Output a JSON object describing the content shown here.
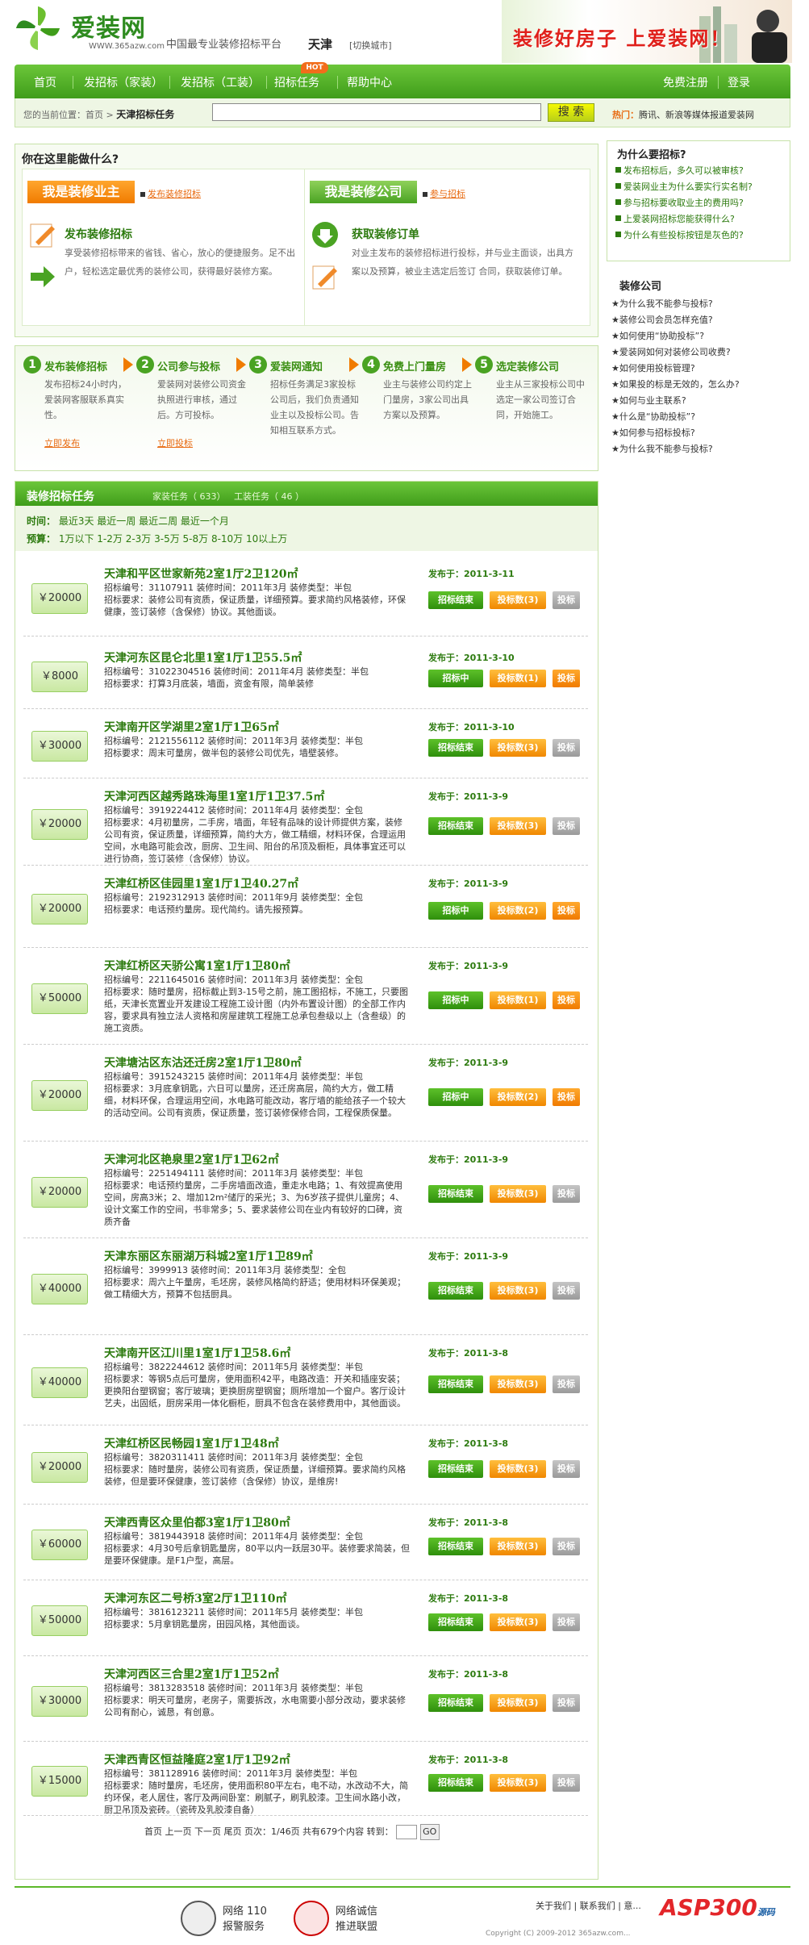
{
  "header": {
    "logo_name": "爱装网",
    "logo_url": "WWW.365azw.com",
    "slogan": "中国最专业装修招标平台",
    "city": "天津",
    "switch_city": "[切换城市]",
    "banner": "装修好房子 上爱装网！"
  },
  "nav": {
    "items": [
      "首页",
      "发招标（家装）",
      "发招标（工装）",
      "招标任务",
      "帮助中心"
    ],
    "hot": "HOT",
    "register": "免费注册",
    "login": "登录"
  },
  "subbar": {
    "crumb_prefix": "您的当前位置：首页 >",
    "crumb_current": "天津招标任务",
    "search_placeholder": "",
    "search_button": "搜 索",
    "hot_label": "热门：",
    "hot_text": "腾讯、新浪等媒体报道爱装网"
  },
  "intro": {
    "title": "你在这里能做什么?",
    "owner": {
      "button": "我是装修业主",
      "link": "发布装修招标",
      "item_title": "发布装修招标",
      "desc": "享受装修招标带来的省钱、省心，放心的便捷服务。足不出户，轻松选定最优秀的装修公司，获得最好装修方案。"
    },
    "company": {
      "button": "我是装修公司",
      "link": "参与招标",
      "item_title": "获取装修订单",
      "desc": "对业主发布的装修招标进行投标，并与业主面谈，出具方案以及预算，被业主选定后签订 合同，获取装修订单。"
    }
  },
  "steps": [
    {
      "num": "1",
      "title": "发布装修招标",
      "desc": "发布招标24小时内，爱装网客服联系真实性。",
      "link": "立即发布"
    },
    {
      "num": "2",
      "title": "公司参与投标",
      "desc": "爱装网对装修公司资金执照进行审核，通过后。方可投标。",
      "link": "立即投标"
    },
    {
      "num": "3",
      "title": "爱装网通知",
      "desc": "招标任务满足3家投标公司后，我们负责通知业主以及投标公司。告知相互联系方式。",
      "link": ""
    },
    {
      "num": "4",
      "title": "免费上门量房",
      "desc": "业主与装修公司约定上门量房，3家公司出具方案以及预算。",
      "link": ""
    },
    {
      "num": "5",
      "title": "选定装修公司",
      "desc": "业主从三家投标公司中选定一家公司签订合同，开始施工。",
      "link": ""
    }
  ],
  "tasks": {
    "title": "装修招标任务",
    "tab_home": "家装任务（ 633）",
    "tab_work": "工装任务（ 46 ）",
    "filter_time_label": "时间：",
    "filter_time": "最近3天  最近一周  最近二周  最近一个月",
    "filter_budget_label": "预算：",
    "filter_budget": "1万以下  1-2万  2-3万  3-5万  5-8万  8-10万  10以上万",
    "items": [
      {
        "price": "￥20000",
        "title": "天津和平区世家新苑2室1厅2卫120㎡",
        "info": "招标编号：31107911   装修时间：2011年3月   装修类型：半包\n招标要求：装修公司有资质，保证质量，详细预算。要求简约风格装修，环保健康，签订装修（含保修）协议。其他面谈。",
        "date": "发布于：2011-3-11",
        "status": "招标结束",
        "bids": "投标数(3)",
        "act": "投标",
        "act_on": false
      },
      {
        "price": "￥8000",
        "title": "天津河东区昆仑北里1室1厅1卫55.5㎡",
        "info": "招标编号：31022304516   装修时间：2011年4月   装修类型：半包\n招标要求：打算3月底装，墙面，资金有限，简单装修",
        "date": "发布于：2011-3-10",
        "status": "招标中",
        "bids": "投标数(1)",
        "act": "投标",
        "act_on": true
      },
      {
        "price": "￥30000",
        "title": "天津南开区学湖里2室1厅1卫65㎡",
        "info": "招标编号：2121556112   装修时间：2011年3月   装修类型：半包\n招标要求：周末可量房，做半包的装修公司优先，墙壁装修。",
        "date": "发布于：2011-3-10",
        "status": "招标结束",
        "bids": "投标数(3)",
        "act": "投标",
        "act_on": false
      },
      {
        "price": "￥20000",
        "title": "天津河西区越秀路珠海里1室1厅1卫37.5㎡",
        "info": "招标编号：3919224412   装修时间：2011年4月   装修类型：全包\n招标要求：4月初量房，二手房，墙面，年轻有品味的设计师提供方案，装修公司有资，保证质量，详细预算，简约大方，做工精细，材料环保，合理运用空间，水电路可能会改，厨房、卫生间、阳台的吊顶及橱柜，具体事宜还可以进行协商，签订装修（含保修）协议。",
        "date": "发布于：2011-3-9",
        "status": "招标结束",
        "bids": "投标数(3)",
        "act": "投标",
        "act_on": false
      },
      {
        "price": "￥20000",
        "title": "天津红桥区佳园里1室1厅1卫40.27㎡",
        "info": "招标编号：2192312913   装修时间：2011年9月   装修类型：全包\n招标要求：电话预约量房。现代简约。请先报预算。",
        "date": "发布于：2011-3-9",
        "status": "招标中",
        "bids": "投标数(2)",
        "act": "投标",
        "act_on": true
      },
      {
        "price": "￥50000",
        "title": "天津红桥区天骄公寓1室1厅1卫80㎡",
        "info": "招标编号：2211645016   装修时间：2011年3月   装修类型：全包\n招标要求：随时量房，招标截止到3-15号之前，施工图招标，不施工，只要图纸，天津长宽置业开发建设工程施工设计图（内外布置设计图）的全部工作内容，要求具有独立法人资格和房屋建筑工程施工总承包叁级以上（含叁级）的施工资质。",
        "date": "发布于：2011-3-9",
        "status": "招标中",
        "bids": "投标数(1)",
        "act": "投标",
        "act_on": true
      },
      {
        "price": "￥20000",
        "title": "天津塘沽区东沽还迁房2室1厅1卫80㎡",
        "info": "招标编号：3915243215   装修时间：2011年4月   装修类型：半包\n招标要求：3月底拿钥匙，六日可以量房，还迁房高层，简约大方，做工精细，材料环保，合理运用空间，水电路可能改动，客厅墙的能给孩子一个较大的活动空间。公司有资质，保证质量，签订装修保修合同，工程保质保量。",
        "date": "发布于：2011-3-9",
        "status": "招标中",
        "bids": "投标数(2)",
        "act": "投标",
        "act_on": true
      },
      {
        "price": "￥20000",
        "title": "天津河北区艳泉里2室1厅1卫62㎡",
        "info": "招标编号：2251494111   装修时间：2011年3月   装修类型：半包\n招标要求：电话预约量房，二手房墙面改造，重走水电路；1、有效提高使用空间，房高3米；2、增加12m²储厅的采光；3、为6岁孩子提供儿童房；4、设计文案工作的空间，书非常多；5、要求装修公司在业内有较好的口碑，资质齐备",
        "date": "发布于：2011-3-9",
        "status": "招标结束",
        "bids": "投标数(3)",
        "act": "投标",
        "act_on": false
      },
      {
        "price": "￥40000",
        "title": "天津东丽区东丽湖万科城2室1厅1卫89㎡",
        "info": "招标编号：3999913   装修时间：2011年3月   装修类型：全包\n招标要求：周六上午量房，毛坯房，装修风格简约舒适；使用材料环保美观；做工精细大方，预算不包括厨具。",
        "date": "发布于：2011-3-9",
        "status": "招标结束",
        "bids": "投标数(3)",
        "act": "投标",
        "act_on": false
      },
      {
        "price": "￥40000",
        "title": "天津南开区江川里1室1厅1卫58.6㎡",
        "info": "招标编号：3822244612   装修时间：2011年5月   装修类型：半包\n招标要求：等钢5点后可量房，使用面积42平，电路改造：开关和插座安装；更换阳台塑钢窗；客厅玻璃；更换厨房塑钢窗；厕所增加一个窗户。客厅设计艺夫，出固纸，厨房采用一体化橱柜，厨具不包含在装修费用中，其他面谈。",
        "date": "发布于：2011-3-8",
        "status": "招标结束",
        "bids": "投标数(3)",
        "act": "投标",
        "act_on": false
      },
      {
        "price": "￥20000",
        "title": "天津红桥区民畅园1室1厅1卫48㎡",
        "info": "招标编号：3820311411   装修时间：2011年3月   装修类型：全包\n招标要求：随时量房，装修公司有资质，保证质量，详细预算。要求简约风格装修，但是要环保健康，签订装修（含保修）协议，是维房!",
        "date": "发布于：2011-3-8",
        "status": "招标结束",
        "bids": "投标数(3)",
        "act": "投标",
        "act_on": false
      },
      {
        "price": "￥60000",
        "title": "天津西青区众里伯都3室1厅1卫80㎡",
        "info": "招标编号：3819443918   装修时间：2011年4月   装修类型：全包\n招标要求：4月30号后拿钥匙量房，80平以内一跃层30平。装修要求简装，但是要环保健康。是F1户型，高层。",
        "date": "发布于：2011-3-8",
        "status": "招标结束",
        "bids": "投标数(3)",
        "act": "投标",
        "act_on": false
      },
      {
        "price": "￥50000",
        "title": "天津河东区二号桥3室2厅1卫110㎡",
        "info": "招标编号：3816123211   装修时间：2011年5月   装修类型：半包\n招标要求：5月拿钥匙量房，田园风格，其他面谈。",
        "date": "发布于：2011-3-8",
        "status": "招标结束",
        "bids": "投标数(3)",
        "act": "投标",
        "act_on": false
      },
      {
        "price": "￥30000",
        "title": "天津河西区三合里2室1厅1卫52㎡",
        "info": "招标编号：3813283518   装修时间：2011年3月   装修类型：半包\n招标要求：明天可量房，老房子，需要拆改，水电需要小部分改动，要求装修公司有耐心，诚恳，有创意。",
        "date": "发布于：2011-3-8",
        "status": "招标结束",
        "bids": "投标数(3)",
        "act": "投标",
        "act_on": false
      },
      {
        "price": "￥15000",
        "title": "天津西青区恒益隆庭2室1厅1卫92㎡",
        "info": "招标编号：381128916   装修时间：2011年3月   装修类型：半包\n招标要求：随时量房，毛坯房，使用面积80平左右，电不动，水改动不大，简约环保，老人居住，客厅及两间卧室：刷腻子，刷乳胶漆。卫生间水路小改，厨卫吊顶及瓷砖。（瓷砖及乳胶漆自备）",
        "date": "发布于：2011-3-8",
        "status": "招标结束",
        "bids": "投标数(3)",
        "act": "投标",
        "act_on": false
      }
    ],
    "pager": "首页  上一页  下一页  尾页  页次：1/46页  共有679个内容  转到：",
    "go": "GO"
  },
  "sidebar": {
    "why_title": "为什么要招标?",
    "why_items": [
      "发布招标后，多久可以被审核?",
      "爱装网业主为什么要实行实名制?",
      "参与招标要收取业主的费用吗?",
      "上爱装网招标您能获得什么?",
      "为什么有些投标按钮是灰色的?"
    ],
    "company_title": "装修公司",
    "company_items": [
      "★为什么我不能参与投标?",
      "★装修公司会员怎样充值?",
      "★如何使用“协助投标”?",
      "★爱装网如何对装修公司收费?",
      "★如何使用投标管理?",
      "★如果投的标是无效的，怎么办?",
      "★如何与业主联系?",
      "★什么是“协助投标”?",
      "★如何参与招标投标?",
      "★为什么我不能参与投标?"
    ]
  },
  "footer": {
    "badge1": "网络 110\n报警服务",
    "badge2": "网络诚信\n推进联盟",
    "links": "关于我们  |  联系我们  |  意...",
    "asp": "ASP300",
    "asp_sub": "源码",
    "copyright": "Copyright (C) 2009-2012 365azw.com..."
  }
}
